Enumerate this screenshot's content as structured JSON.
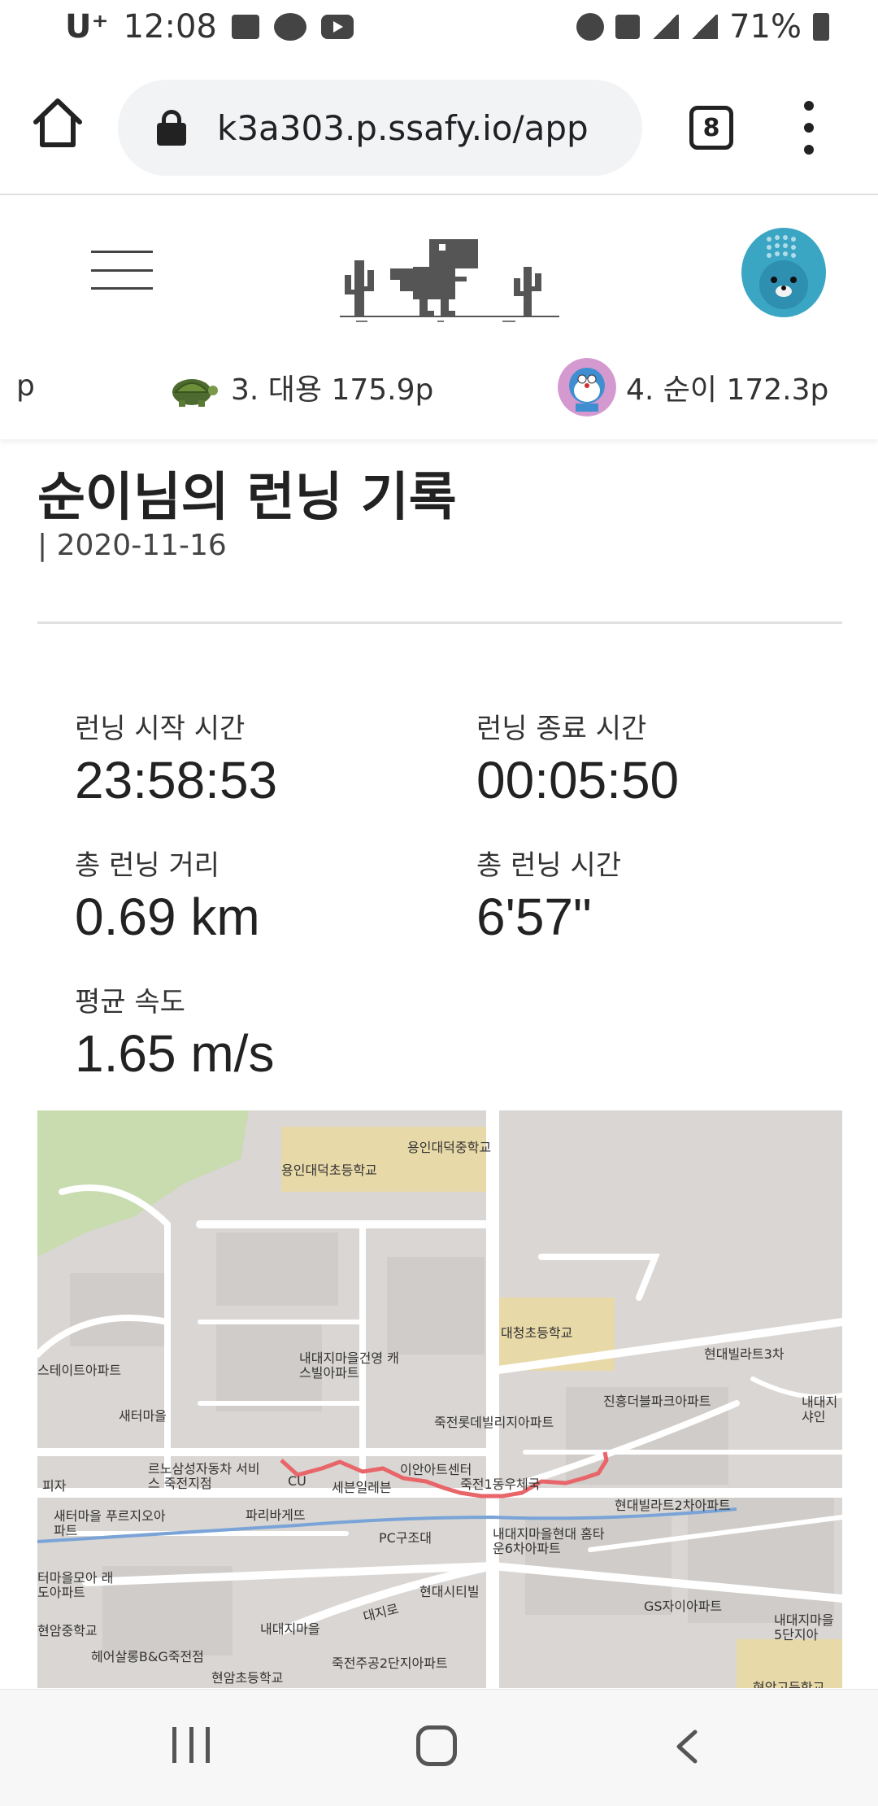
{
  "status_bar": {
    "carrier": "U⁺",
    "time": "12:08",
    "battery": "71%"
  },
  "browser": {
    "url": "k3a303.p.ssafy.io/app",
    "tab_count": "8"
  },
  "ranking": {
    "partial_prev": "p",
    "items": [
      {
        "rank_label": "3. 대용 175.9p",
        "icon": "turtle-icon"
      },
      {
        "rank_label": "4. 순이 172.3p",
        "icon": "doraemon-avatar"
      }
    ]
  },
  "record": {
    "title": "순이님의 런닝 기록",
    "date": "| 2020-11-16",
    "start_label": "런닝 시작 시간",
    "start_value": "23:58:53",
    "end_label": "런닝 종료 시간",
    "end_value": "00:05:50",
    "distance_label": "총 런닝 거리",
    "distance_value": "0.69 km",
    "duration_label": "총 런닝 시간",
    "duration_value": "6'57\"",
    "speed_label": "평균 속도",
    "speed_value": "1.65 m/s"
  },
  "map": {
    "labels": [
      "용인대덕중학교",
      "용인대덕초등학교",
      "대청초등학교",
      "현대빌라트3차",
      "스테이트아파트",
      "내대지마을건영 캐스빌아파트",
      "새터마을",
      "진흥더블파크아파트",
      "죽전롯데빌리지아파트",
      "내대지 샤인",
      "이안아트센터",
      "죽전1동우체국",
      "르노삼성자동차 서비스 죽전지점",
      "세븐일레븐",
      "피자",
      "현대빌라트2차아파트",
      "새터마을 푸르지오아파트",
      "파리바게뜨",
      "PC구조대",
      "내대지마을현대 홈타운6차아파트",
      "터마을모아 래도아파트",
      "현대시티빌",
      "GS자이아파트",
      "현암중학교",
      "내대지마을",
      "대지로",
      "내대지마을 5단지아",
      "헤어살롱B&G죽전점",
      "죽전주공2단지아파트",
      "현암초등학교",
      "현암고등학교",
      "CU"
    ]
  },
  "colors": {
    "accent_route": "#e8666a",
    "map_bg": "#d9d6d3",
    "map_road": "#ffffff",
    "map_school": "#e8d9a8",
    "map_park": "#c8dcb0",
    "map_stream": "#7aa4d8"
  }
}
